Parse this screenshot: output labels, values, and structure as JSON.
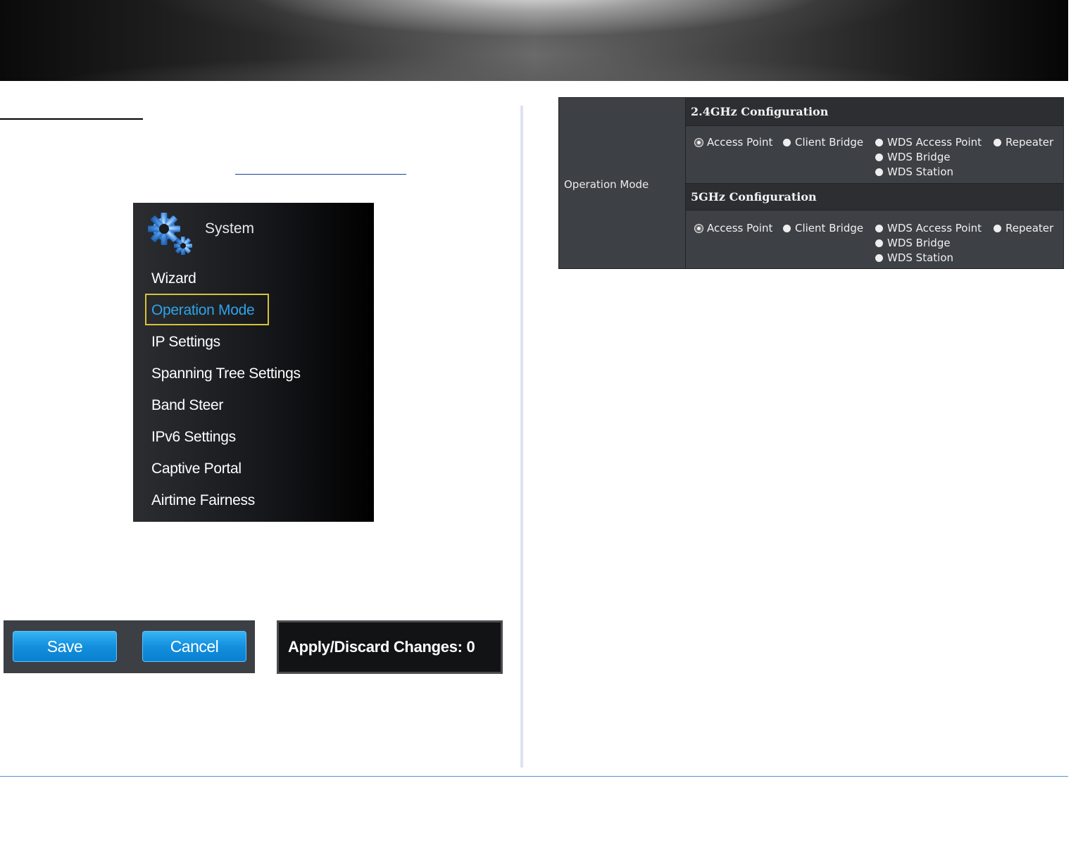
{
  "system_menu": {
    "title": "System",
    "items": [
      {
        "label": "Wizard"
      },
      {
        "label": "Operation Mode",
        "active": true
      },
      {
        "label": "IP Settings"
      },
      {
        "label": "Spanning Tree Settings"
      },
      {
        "label": "Band Steer"
      },
      {
        "label": "IPv6 Settings"
      },
      {
        "label": "Captive Portal"
      },
      {
        "label": "Airtime Fairness"
      }
    ]
  },
  "buttons": {
    "save_label": "Save",
    "cancel_label": "Cancel"
  },
  "apply_discard": {
    "label": "Apply/Discard Changes: 0"
  },
  "operation_mode_panel": {
    "row_label": "Operation Mode",
    "configs": [
      {
        "title": "2.4GHz Configuration",
        "options": [
          "Access Point",
          "Client Bridge",
          "WDS Access Point",
          "Repeater",
          "WDS Bridge",
          "WDS Station"
        ],
        "selected": "Access Point"
      },
      {
        "title": "5GHz Configuration",
        "options": [
          "Access Point",
          "Client Bridge",
          "WDS Access Point",
          "Repeater",
          "WDS Bridge",
          "WDS Station"
        ],
        "selected": "Access Point"
      }
    ]
  },
  "colors": {
    "accent_blue": "#2ea3e8",
    "highlight_border": "#d6c33a",
    "button_blue": "#138fdd",
    "panel_bg": "#3d4045"
  },
  "icons": {
    "system": "gear-icon"
  }
}
